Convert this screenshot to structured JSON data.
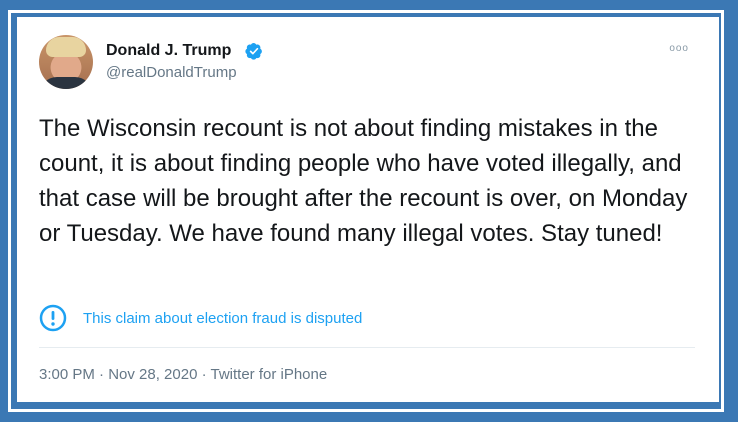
{
  "tweet": {
    "author_name": "Donald J. Trump",
    "handle": "@realDonaldTrump",
    "text": "The Wisconsin recount is not about finding mistakes in the count, it is about finding people who have voted illegally, and that case will be brought after the recount is over, on Monday or Tuesday. We have found many illegal votes. Stay tuned!",
    "notice": "This claim about election fraud is disputed",
    "meta": "3:00 PM · Nov 28, 2020 · Twitter for iPhone",
    "more_glyph": "ooo"
  },
  "icons": {
    "verified": "verified-badge-icon",
    "notice": "exclamation-circle-icon",
    "more": "more-options-icon"
  },
  "colors": {
    "frame_background": "#3b78b4",
    "accent": "#1da1f2",
    "text": "#14171a",
    "secondary_text": "#657786"
  }
}
